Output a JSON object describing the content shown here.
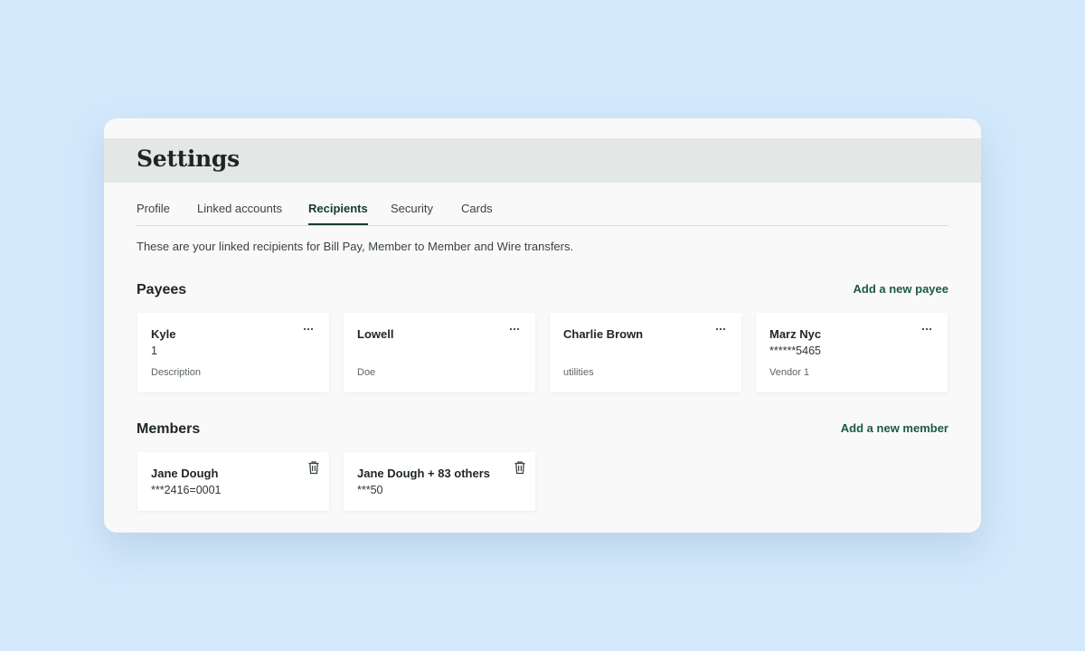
{
  "page": {
    "title": "Settings",
    "intro": "These are your linked recipients for Bill Pay, Member to Member and Wire transfers."
  },
  "tabs": [
    {
      "label": "Profile",
      "active": false
    },
    {
      "label": "Linked accounts",
      "active": false
    },
    {
      "label": "Recipients",
      "active": true
    },
    {
      "label": "Security",
      "active": false
    },
    {
      "label": "Cards",
      "active": false
    }
  ],
  "payees": {
    "title": "Payees",
    "add_label": "Add a new payee",
    "items": [
      {
        "name": "Kyle",
        "account": "1",
        "description": "Description"
      },
      {
        "name": "Lowell",
        "account": "",
        "description": "Doe"
      },
      {
        "name": "Charlie Brown",
        "account": "",
        "description": "utilities"
      },
      {
        "name": "Marz Nyc",
        "account": "******5465",
        "description": "Vendor 1"
      }
    ]
  },
  "members": {
    "title": "Members",
    "add_label": "Add a new member",
    "items": [
      {
        "name": "Jane Dough",
        "account": "***2416=0001"
      },
      {
        "name": "Jane Dough + 83 others",
        "account": "***50"
      }
    ]
  },
  "icons": {
    "more": "more-horizontal-icon",
    "delete": "trash-icon"
  },
  "colors": {
    "background": "#d3e8fb",
    "accent": "#1d5a3f",
    "active_tab": "#173b2e",
    "header_band": "#e3e7e5"
  }
}
